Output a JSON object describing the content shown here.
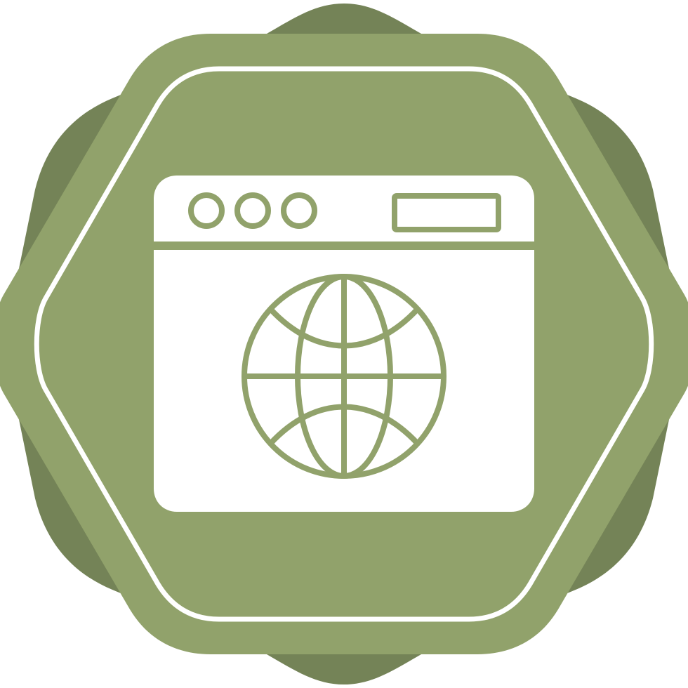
{
  "icon": {
    "name": "web-browser-globe-badge",
    "symbol": "globe-icon",
    "window_dots": 3
  },
  "colors": {
    "background": "#ffffff",
    "badge_outer": "#748357",
    "badge_inner": "#91a26b",
    "line": "#ffffff",
    "window_fill": "#ffffff",
    "globe_stroke": "#91a26b"
  }
}
